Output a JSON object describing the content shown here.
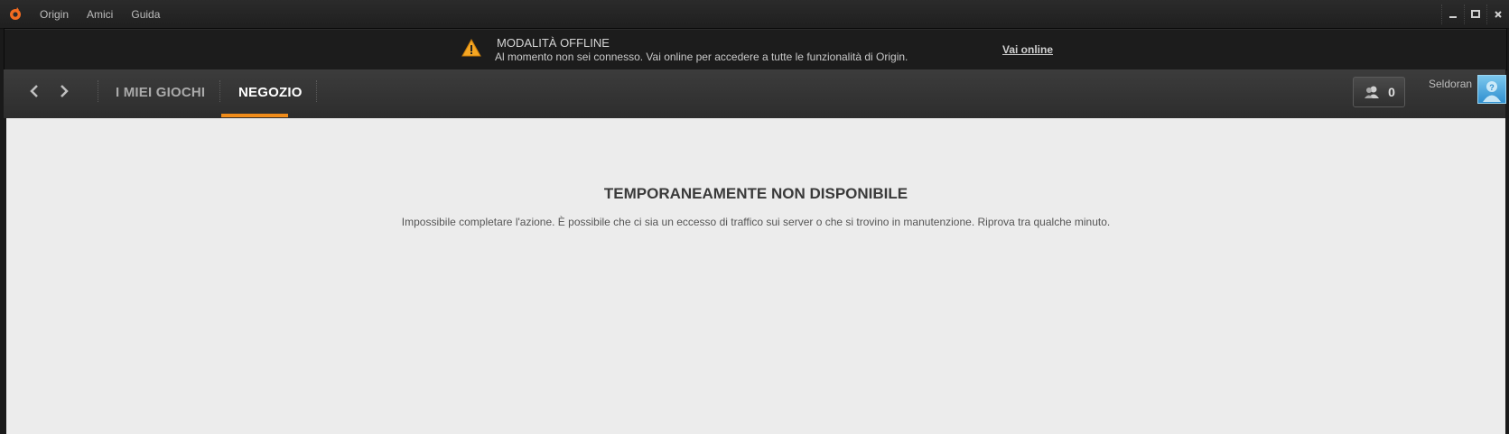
{
  "titlebar": {
    "menu": [
      "Origin",
      "Amici",
      "Guida"
    ],
    "controls": [
      "minimize",
      "maximize",
      "close"
    ]
  },
  "offline_banner": {
    "title": "MODALITÀ OFFLINE",
    "message": "Al momento non sei connesso. Vai online per accedere a tutte le funzionalità di Origin.",
    "action": "Vai online"
  },
  "nav": {
    "tabs": [
      {
        "label": "I MIEI GIOCHI",
        "active": false
      },
      {
        "label": "NEGOZIO",
        "active": true
      }
    ],
    "friends_count": "0",
    "username": "Seldoran",
    "accent": "#f08c1a"
  },
  "content": {
    "title": "TEMPORANEAMENTE NON DISPONIBILE",
    "message": "Impossibile completare l'azione. È possibile che ci sia un eccesso di traffico sui server o che si trovino in manutenzione. Riprova tra qualche minuto."
  }
}
